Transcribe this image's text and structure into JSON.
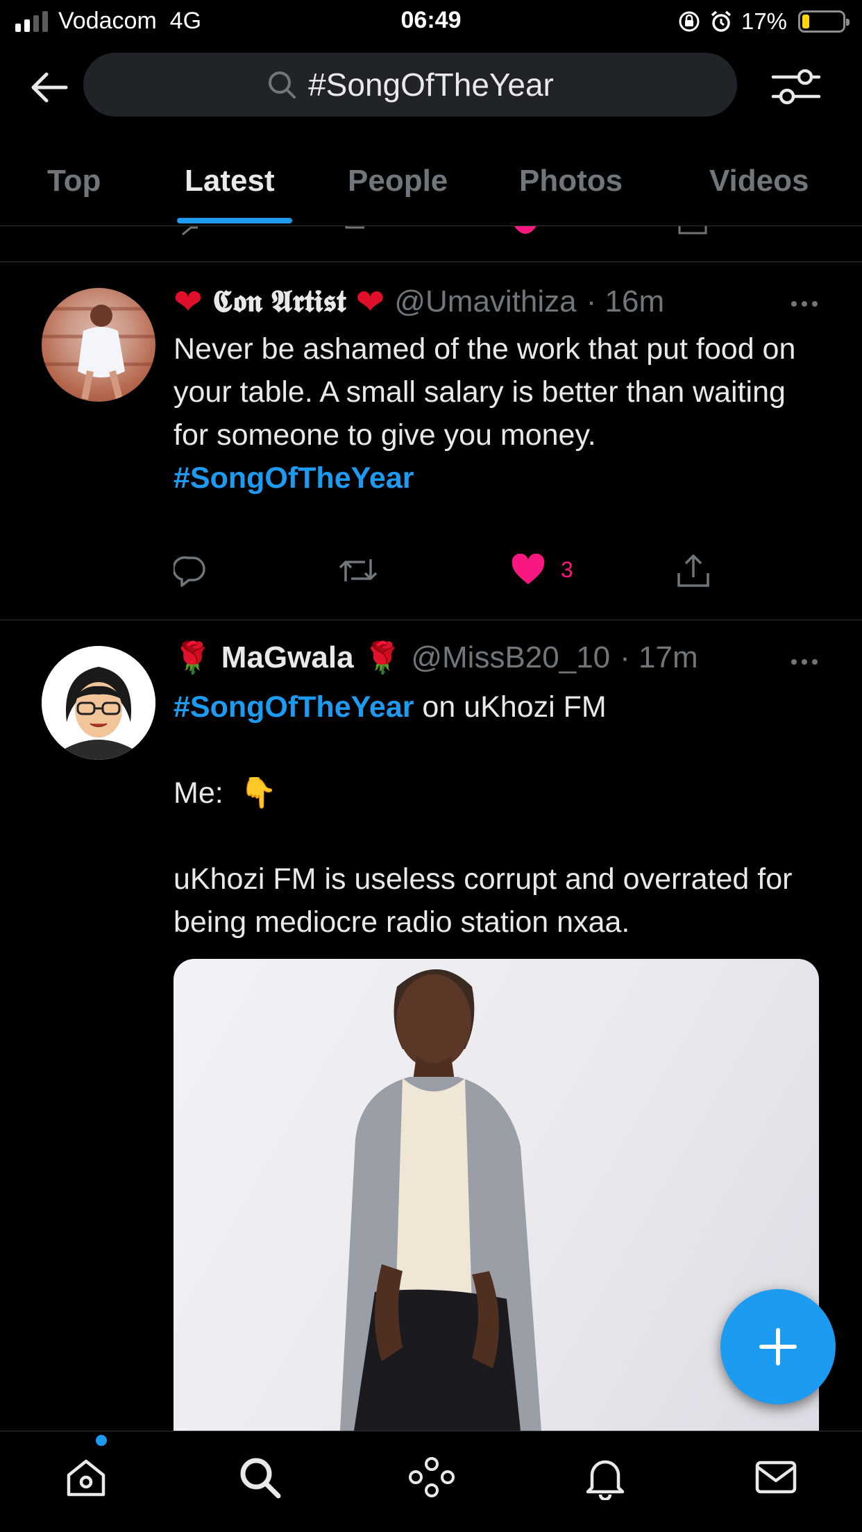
{
  "status_bar": {
    "carrier": "Vodacom",
    "network": "4G",
    "time": "06:49",
    "battery_percent_label": "17%",
    "battery_level": 0.17,
    "signal_bars_active": 2,
    "signal_bars_total": 4
  },
  "search": {
    "query": "#SongOfTheYear",
    "back_icon": "arrow-left-icon",
    "search_icon": "magnifier-icon",
    "filter_icon": "sliders-icon"
  },
  "tabs": {
    "items": [
      {
        "label": "Top"
      },
      {
        "label": "Latest"
      },
      {
        "label": "People"
      },
      {
        "label": "Photos"
      },
      {
        "label": "Videos"
      }
    ],
    "active": "Latest"
  },
  "tweets": [
    {
      "display_name": "𝕮𝖔𝖓 𝕬𝖗𝖙𝖎𝖘𝖙",
      "name_decoration": "❤️",
      "handle": "@Umavithiza",
      "time": "· 16m",
      "text": "Never be ashamed of the work that put food on your table. A small salary is better than waiting for someone to give you money.",
      "hashtag": "#SongOfTheYear",
      "likes": "3",
      "liked": true
    },
    {
      "display_name": "MaGwala",
      "name_decoration": "🌹",
      "handle": "@MissB20_10",
      "time": "· 17m",
      "hashtag": "#SongOfTheYear",
      "line1_rest": " on uKhozi FM",
      "line2": "Me:",
      "line2_emoji": "👇",
      "line3": "uKhozi FM is useless corrupt and overrated for being mediocre radio station nxaa."
    }
  ],
  "colors": {
    "accent": "#1d9bf0",
    "like": "#f91880",
    "background": "#000000",
    "secondary_text": "#71767b"
  },
  "bottom_nav": [
    "home-icon",
    "search-icon",
    "spaces-icon",
    "notifications-icon",
    "messages-icon"
  ],
  "compose_icon": "plus-icon"
}
